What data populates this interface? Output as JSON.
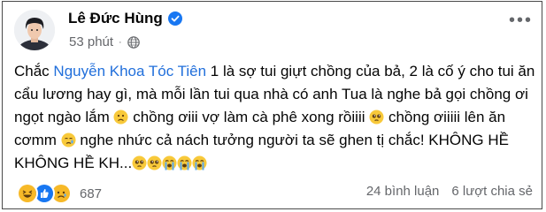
{
  "post": {
    "author_name": "Lê Đức Hùng",
    "time_ago": "53 phút",
    "separator": "·",
    "text_part1": "Chắc ",
    "mention": "Nguyễn Khoa Tóc Tiên",
    "text_part2": " 1 là sợ tui giựt chồng của bả, 2 là cố ý cho tui ăn cẩu lương hay gì, mà mỗi lần tui qua nhà có anh Tua là nghe bả gọi chồng ơi ngọt ngào lắm ",
    "text_part3": " chồng ơiii vợ làm cà phê xong rồiiii ",
    "text_part4": " chồng ơiiiii lên ăn cơmm ",
    "text_part5": " nghe nhức cả nách tưởng người ta sẽ ghen tị chắc! KHÔNG HỀ KHÔNG HỀ KH...",
    "more_icon": "ellipsis-icon"
  },
  "footer": {
    "reaction_count": "687",
    "comments": "24 bình luận",
    "shares": "6 lượt chia sẻ"
  },
  "colors": {
    "mention": "#216fdb",
    "verified": "#1877f2",
    "meta_text": "#65676b",
    "border": "#4a4a4a"
  }
}
